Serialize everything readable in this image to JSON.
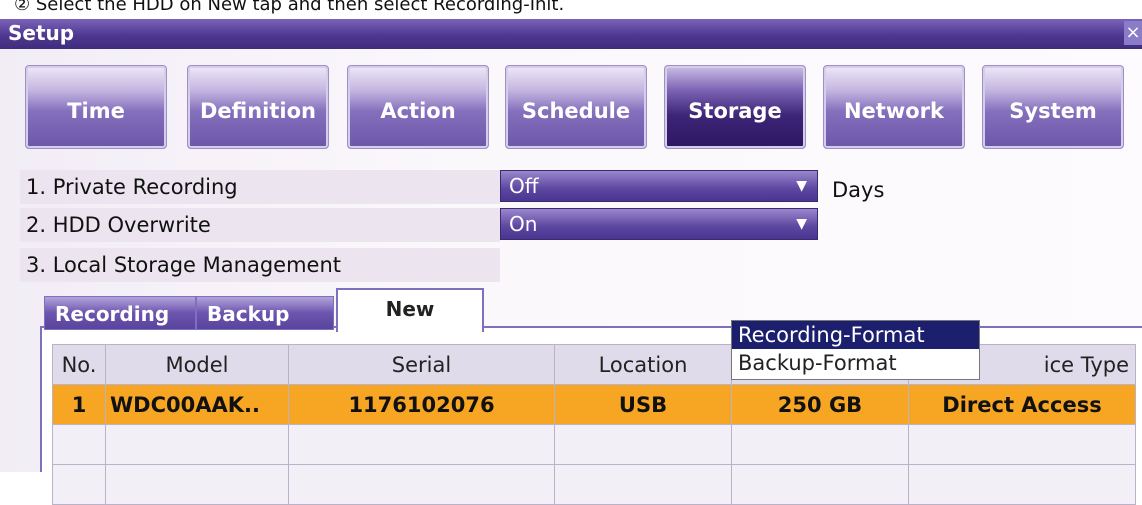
{
  "caption": "② Select the HDD on New tap and then select Recording-Init.",
  "window": {
    "title": "Setup",
    "close_glyph": "×"
  },
  "tabs": [
    {
      "label": "Time"
    },
    {
      "label": "Definition"
    },
    {
      "label": "Action"
    },
    {
      "label": "Schedule"
    },
    {
      "label": "Storage",
      "active": true
    },
    {
      "label": "Network"
    },
    {
      "label": "System"
    }
  ],
  "settings": {
    "private_recording": {
      "label": "1. Private Recording",
      "value": "Off",
      "unit": "Days"
    },
    "hdd_overwrite": {
      "label": "2. HDD Overwrite",
      "value": "On"
    },
    "local_storage": {
      "label": "3. Local Storage Management"
    }
  },
  "subtabs": [
    {
      "label": "Recording"
    },
    {
      "label": "Backup"
    },
    {
      "label": "New",
      "active": true
    }
  ],
  "table": {
    "headers": [
      "No.",
      "Model",
      "Serial",
      "Location",
      "",
      "ice Type"
    ],
    "rows": [
      [
        "1",
        "WDC00AAK..",
        "1176102076",
        "USB",
        "250 GB",
        "Direct Access"
      ]
    ]
  },
  "context_menu": [
    {
      "label": "Recording-Format",
      "highlighted": true
    },
    {
      "label": "Backup-Format"
    }
  ],
  "colors": {
    "accent": "#4e3890",
    "selected_row": "#f6a623",
    "menu_highlight": "#1b1f6e"
  }
}
